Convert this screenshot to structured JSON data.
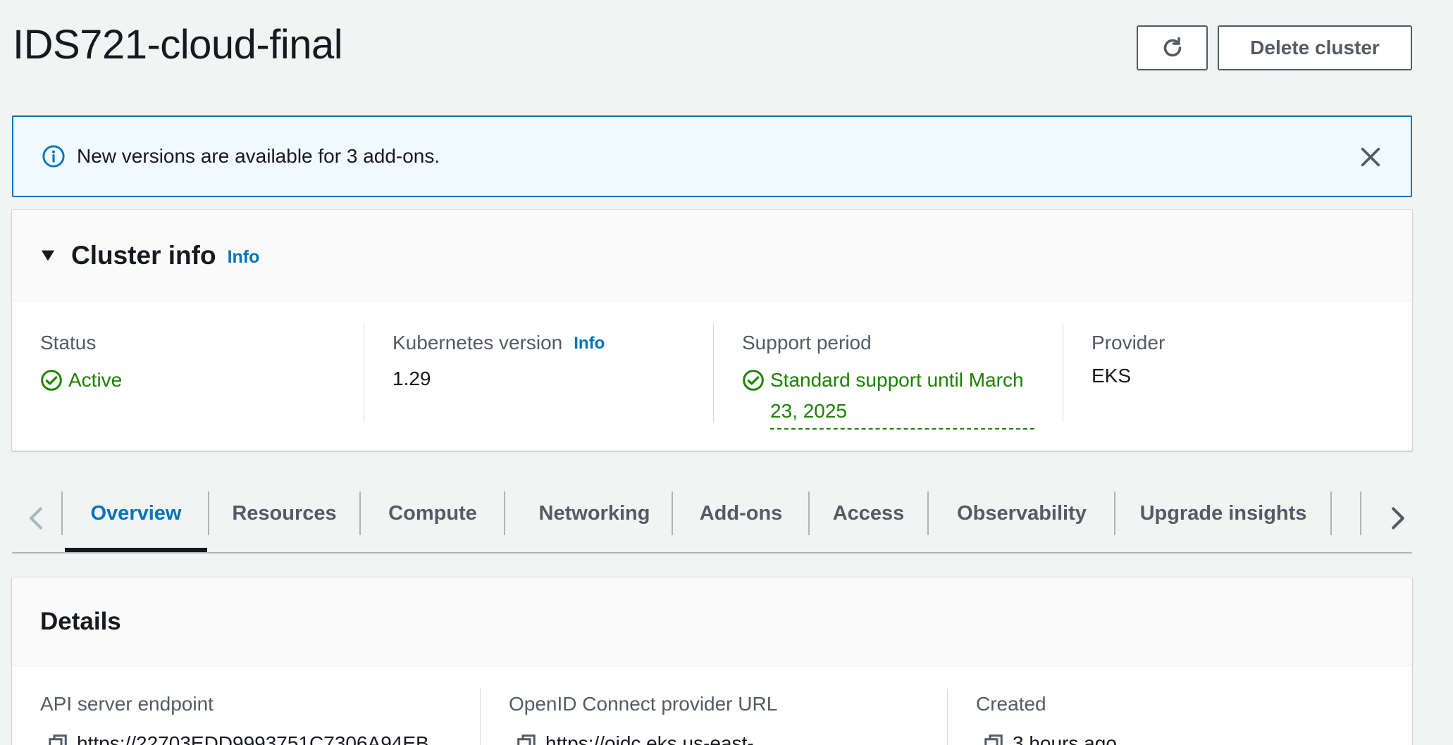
{
  "header": {
    "title": "IDS721-cloud-final",
    "refresh_icon": "refresh-icon",
    "delete_label": "Delete cluster"
  },
  "flash": {
    "message": "New versions are available for 3 add-ons.",
    "icon": "info-icon",
    "close_icon": "close-icon",
    "accent": "#0073bb",
    "background": "#f1faff"
  },
  "cluster_info": {
    "title": "Cluster info",
    "info_link": "Info",
    "status": {
      "label": "Status",
      "value": "Active"
    },
    "kubernetes_version": {
      "label": "Kubernetes version",
      "info_link": "Info",
      "value": "1.29"
    },
    "support_period": {
      "label": "Support period",
      "value": "Standard support until March 23, 2025"
    },
    "provider": {
      "label": "Provider",
      "value": "EKS"
    },
    "success_color": "#1d8102"
  },
  "tabs": {
    "items": [
      {
        "label": "Overview"
      },
      {
        "label": "Resources"
      },
      {
        "label": "Compute"
      },
      {
        "label": "Networking"
      },
      {
        "label": "Add-ons"
      },
      {
        "label": "Access"
      },
      {
        "label": "Observability"
      },
      {
        "label": "Upgrade insights"
      }
    ],
    "active": "Overview",
    "active_color": "#0073bb"
  },
  "details": {
    "title": "Details",
    "api_server_endpoint": {
      "label": "API server endpoint",
      "value": "https://22703EDD9993751C7306A94EB"
    },
    "oidc_provider_url": {
      "label": "OpenID Connect provider URL",
      "value": "https://oidc.eks.us-east-"
    },
    "created": {
      "label": "Created",
      "value": "3 hours ago"
    }
  }
}
